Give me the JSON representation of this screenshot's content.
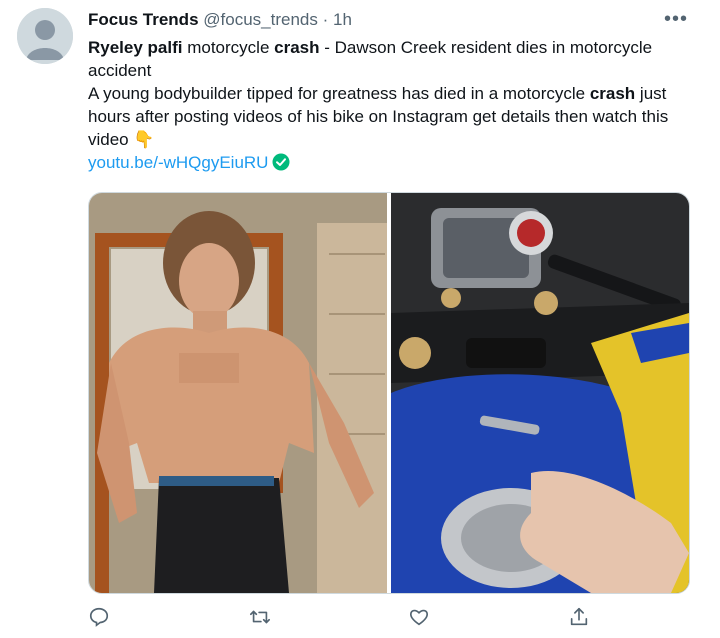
{
  "tweet": {
    "author": {
      "name": "Focus Trends",
      "handle": "@focus_trends",
      "separator": "·",
      "time": "1h"
    },
    "more_label": "•••",
    "line1": {
      "part1": "Ryeley palfi",
      "part2": " motorcycle ",
      "part3": "crash",
      "part4": " - Dawson Creek resident dies in motorcycle accident"
    },
    "line2": {
      "part1": "A young bodybuilder tipped for greatness has died in a motorcycle ",
      "part2": "crash",
      "part3": " just hours after posting videos of his bike on Instagram get details then watch this video ",
      "emoji": "👇"
    },
    "link": "youtu.be/-wHQgyEiuRU",
    "media": [
      {
        "name": "bodybuilder-photo"
      },
      {
        "name": "motorcycle-tank-photo"
      }
    ],
    "actions": [
      "reply-icon",
      "retweet-icon",
      "like-icon",
      "share-icon"
    ],
    "colors": {
      "link": "#1d9bf0",
      "muted": "#536471",
      "verified": "#00ba7c"
    }
  }
}
